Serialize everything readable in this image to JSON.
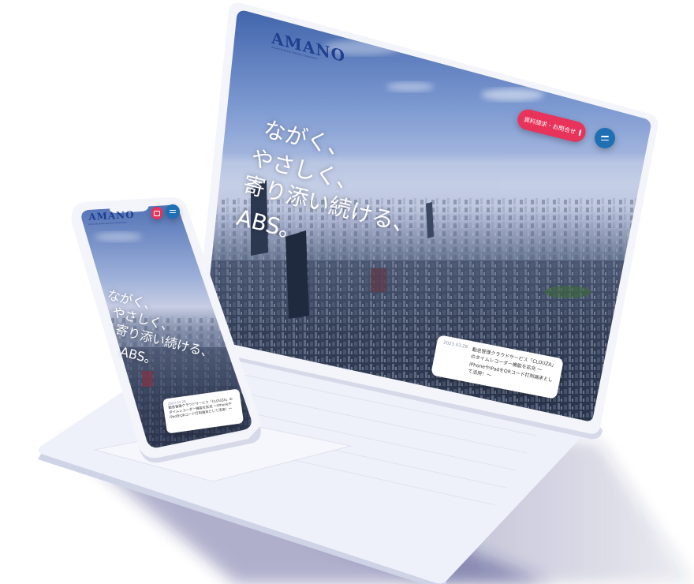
{
  "desktop": {
    "logo": "AMANO",
    "logo_sub": "Amano Business Solutions Corporation",
    "catch_lines": [
      "ながく、",
      "やさしく、",
      "寄り添い続ける、",
      "ABS。"
    ],
    "contact_button": "資料請求・お問合せ",
    "news": {
      "date": "2023.03.28",
      "text": "勤怠管理クラウドサービス「CLOUZA」のタイムレコーダー機能を拡充 ～iPhoneやiPadをQRコード打刻端末として活用！～"
    }
  },
  "mobile": {
    "logo": "AMANO",
    "logo_sub": "Amano Business Solutions Corporation",
    "catch_lines": [
      "ながく、",
      "やさしく、",
      "寄り添い続ける、",
      "ABS。"
    ],
    "news": {
      "date": "2023.03.28",
      "text": "勤怠管理クラウドサービス「CLOUZA」のタイムレコーダー機能を拡充 ～iPhoneやiPadをQRコード打刻端末として活用！～"
    }
  },
  "colors": {
    "accent_red": "#e8335a",
    "menu_blue": "#1e6fb4",
    "device_white": "#f2f4fb"
  },
  "icons": {
    "contact_icon": "envelope-icon",
    "menu_icon": "hamburger-icon"
  }
}
